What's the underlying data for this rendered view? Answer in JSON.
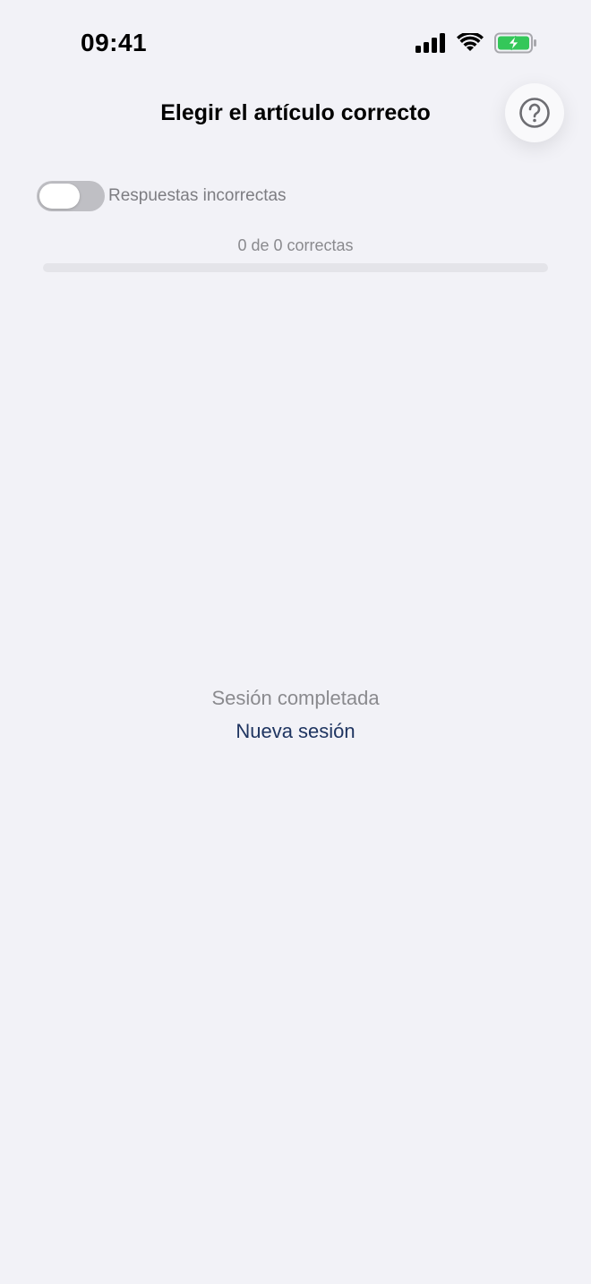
{
  "status_bar": {
    "time": "09:41",
    "icons": [
      "cellular-signal-icon",
      "wifi-icon",
      "battery-charging-icon"
    ],
    "battery_color": "#34c759"
  },
  "header": {
    "title": "Elegir el artículo correcto",
    "help_icon": "question-circle-icon"
  },
  "toggle": {
    "label": "Respuestas incorrectas",
    "on": false
  },
  "progress": {
    "text": "0 de 0 correctas",
    "fraction": 0
  },
  "session": {
    "status": "Sesión completada",
    "new_session_label": "Nueva sesión"
  },
  "colors": {
    "background": "#f2f2f7",
    "accent": "#1f3561"
  }
}
